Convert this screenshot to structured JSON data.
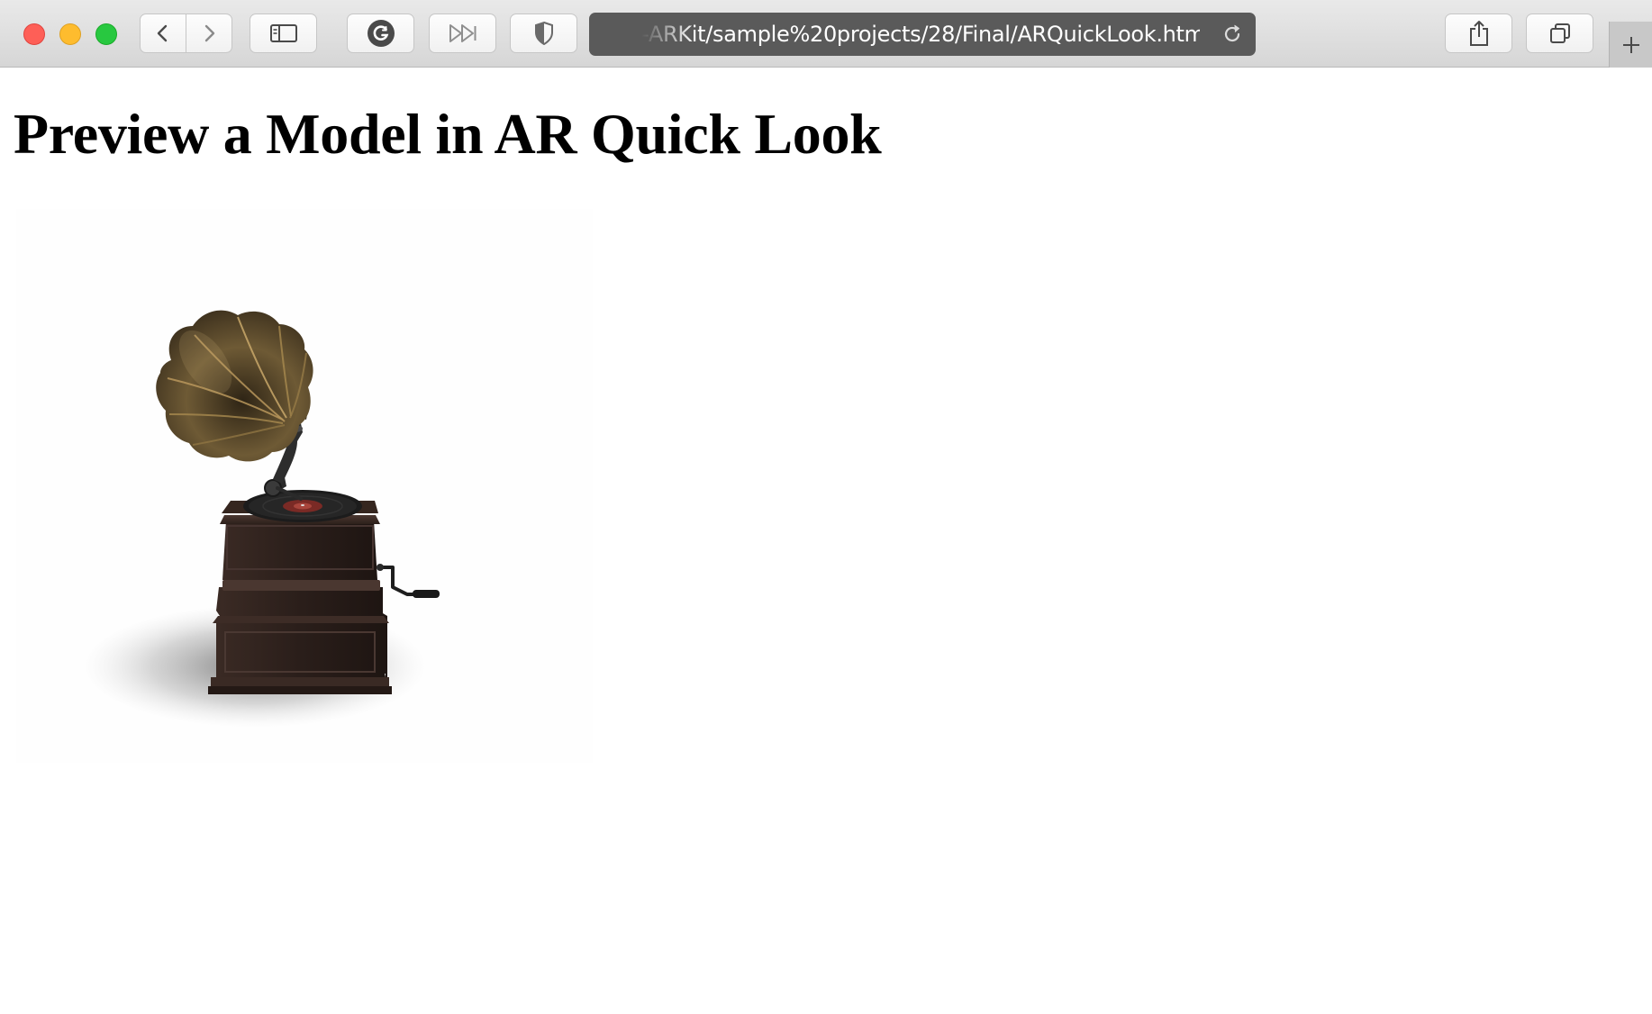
{
  "browser": {
    "url": "-ARKit/sample%20projects/28/Final/ARQuickLook.html",
    "buttons": {
      "back": "chevron-left-icon",
      "forward": "chevron-right-icon",
      "sidebar": "sidebar-icon",
      "extension": "grammarly-icon",
      "skip": "fast-forward-icon",
      "privacy": "shield-icon",
      "reload": "reload-icon",
      "share": "share-icon",
      "tabs": "tabs-overview-icon",
      "new_tab": "plus-icon"
    }
  },
  "page": {
    "title": "Preview a Model in AR Quick Look",
    "model": "gramophone"
  },
  "colors": {
    "toolbar_bg": "#dcdcdc",
    "address_bar_bg": "#5a5a5a",
    "close": "#fe5f57",
    "minimize": "#febc2e",
    "zoom": "#28c840"
  }
}
